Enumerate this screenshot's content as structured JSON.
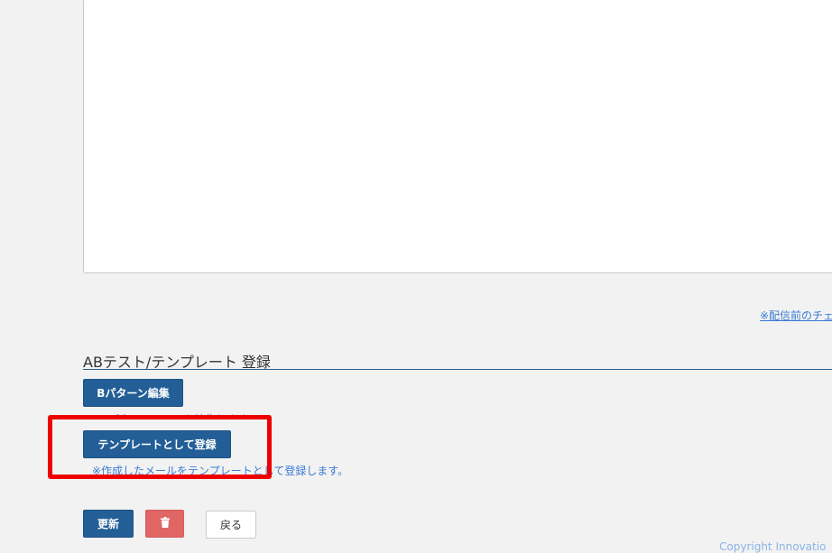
{
  "links": {
    "pre_send_check": "※配信前のチェ"
  },
  "ab_section": {
    "title": "ABテスト/テンプレート 登録",
    "b_pattern_button": "Bパターン編集",
    "b_pattern_note": "※Bパターンメールを編集します。",
    "template_button": "テンプレートとして登録",
    "template_note": "※作成したメールをテンプレートとして登録します。"
  },
  "actions": {
    "update": "更新",
    "back": "戻る"
  },
  "icons": {
    "delete": "trash-icon"
  },
  "footer": {
    "copyright": "Copyright Innovatio"
  },
  "colors": {
    "primary": "#235f96",
    "danger": "#e06666",
    "highlight": "#ee0000",
    "link": "#3a7bd5"
  }
}
